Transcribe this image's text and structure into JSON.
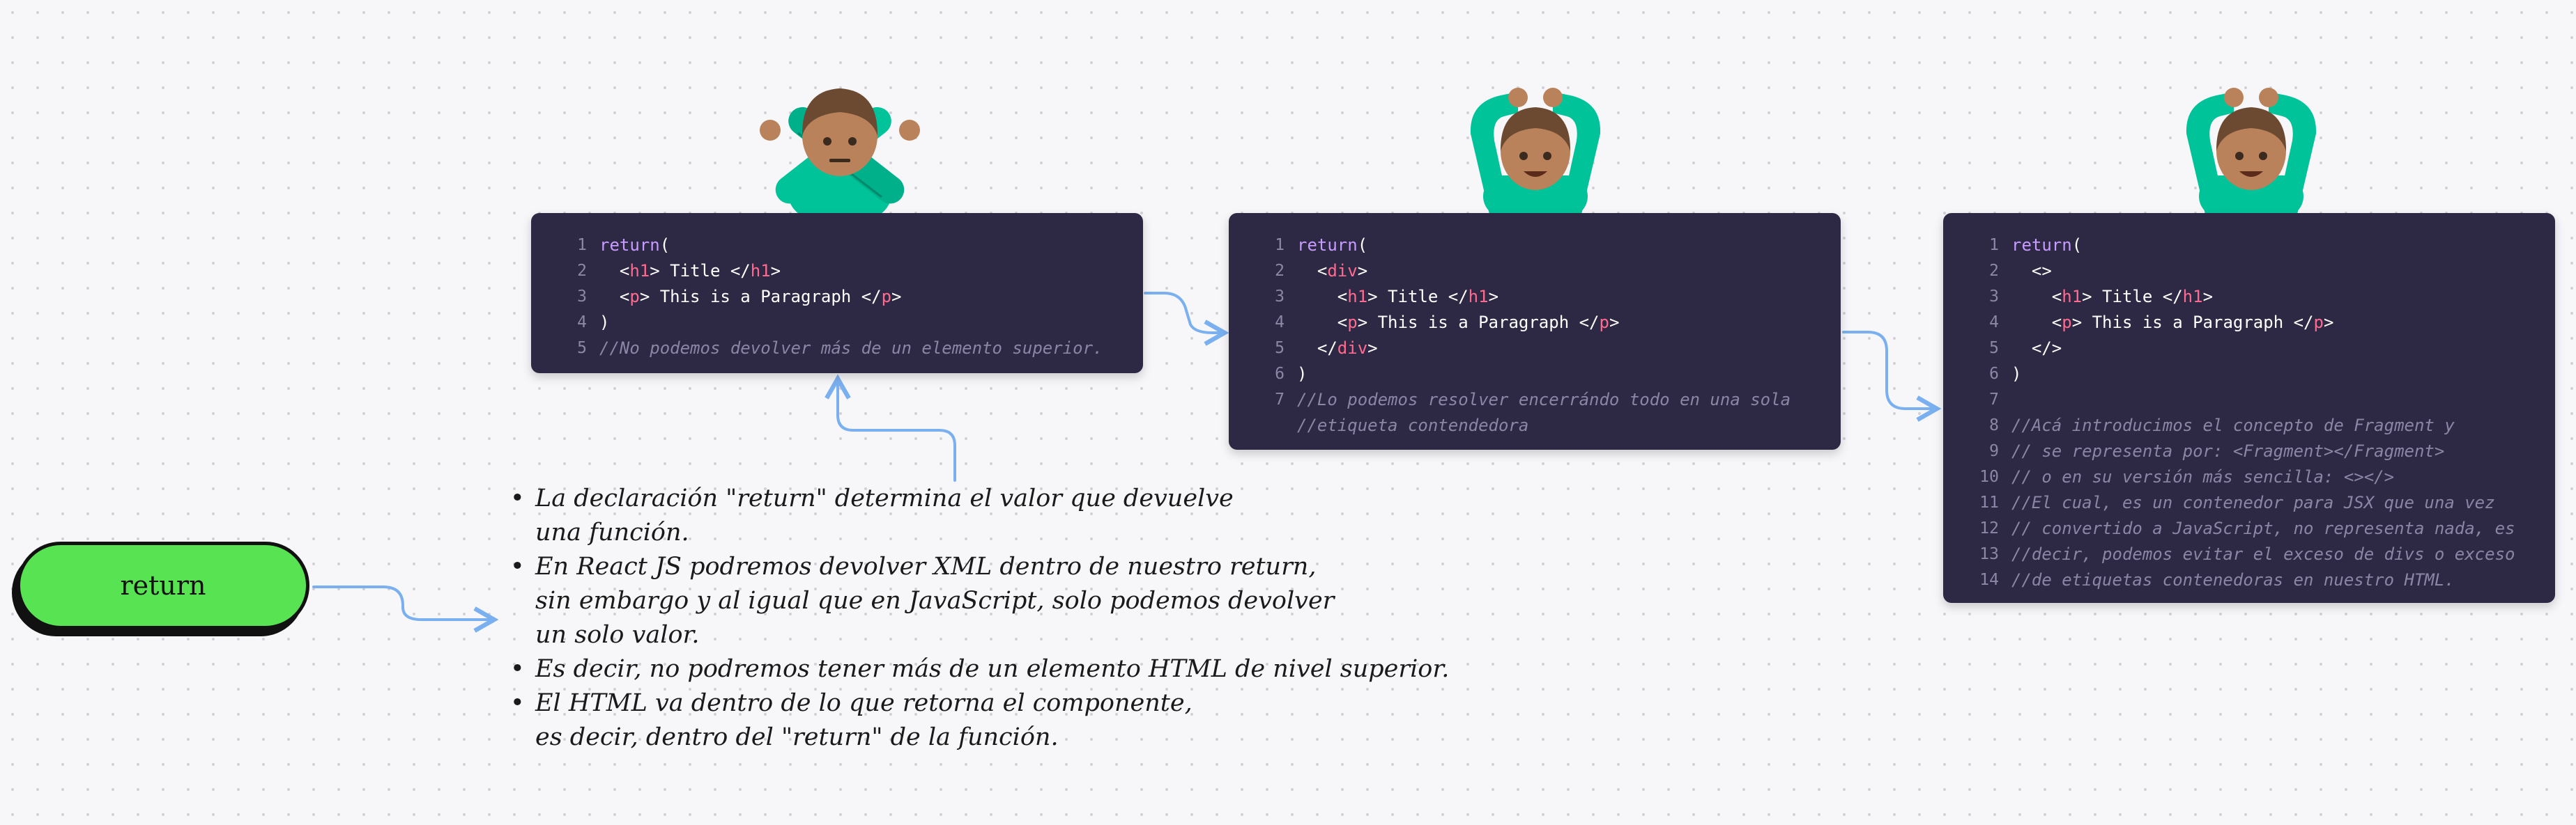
{
  "pill": {
    "label": "return"
  },
  "blocks": [
    {
      "id": "block-1",
      "lines": [
        {
          "n": "1",
          "segs": [
            [
              "kw",
              "return"
            ],
            [
              "p",
              "("
            ]
          ]
        },
        {
          "n": "2",
          "segs": [
            [
              "p",
              "  <"
            ],
            [
              "tag",
              "h1"
            ],
            [
              "p",
              "> Title </"
            ],
            [
              "tag",
              "h1"
            ],
            [
              "p",
              ">"
            ]
          ]
        },
        {
          "n": "3",
          "segs": [
            [
              "p",
              "  <"
            ],
            [
              "tag",
              "p"
            ],
            [
              "p",
              "> This is a Paragraph </"
            ],
            [
              "tag",
              "p"
            ],
            [
              "p",
              ">"
            ]
          ]
        },
        {
          "n": "4",
          "segs": [
            [
              "p",
              ")"
            ]
          ]
        },
        {
          "n": "5",
          "segs": [
            [
              "cm",
              "//No podemos devolver más de un elemento superior."
            ]
          ]
        }
      ]
    },
    {
      "id": "block-2",
      "lines": [
        {
          "n": "1",
          "segs": [
            [
              "kw",
              "return"
            ],
            [
              "p",
              "("
            ]
          ]
        },
        {
          "n": "2",
          "segs": [
            [
              "p",
              "  <"
            ],
            [
              "tag",
              "div"
            ],
            [
              "p",
              ">"
            ]
          ]
        },
        {
          "n": "3",
          "segs": [
            [
              "p",
              "    <"
            ],
            [
              "tag",
              "h1"
            ],
            [
              "p",
              "> Title </"
            ],
            [
              "tag",
              "h1"
            ],
            [
              "p",
              ">"
            ]
          ]
        },
        {
          "n": "4",
          "segs": [
            [
              "p",
              "    <"
            ],
            [
              "tag",
              "p"
            ],
            [
              "p",
              "> This is a Paragraph </"
            ],
            [
              "tag",
              "p"
            ],
            [
              "p",
              ">"
            ]
          ]
        },
        {
          "n": "5",
          "segs": [
            [
              "p",
              "  </"
            ],
            [
              "tag",
              "div"
            ],
            [
              "p",
              ">"
            ]
          ]
        },
        {
          "n": "6",
          "segs": [
            [
              "p",
              ")"
            ]
          ]
        },
        {
          "n": "7",
          "segs": [
            [
              "cm",
              "//Lo podemos resolver encerrándo todo en una sola"
            ]
          ]
        },
        {
          "n": "",
          "segs": [
            [
              "cm",
              "//etiqueta contendedora"
            ]
          ]
        }
      ]
    },
    {
      "id": "block-3",
      "lines": [
        {
          "n": "1",
          "segs": [
            [
              "kw",
              "return"
            ],
            [
              "p",
              "("
            ]
          ]
        },
        {
          "n": "2",
          "segs": [
            [
              "p",
              "  <>"
            ]
          ]
        },
        {
          "n": "3",
          "segs": [
            [
              "p",
              "    <"
            ],
            [
              "tag",
              "h1"
            ],
            [
              "p",
              "> Title </"
            ],
            [
              "tag",
              "h1"
            ],
            [
              "p",
              ">"
            ]
          ]
        },
        {
          "n": "4",
          "segs": [
            [
              "p",
              "    <"
            ],
            [
              "tag",
              "p"
            ],
            [
              "p",
              "> This is a Paragraph </"
            ],
            [
              "tag",
              "p"
            ],
            [
              "p",
              ">"
            ]
          ]
        },
        {
          "n": "5",
          "segs": [
            [
              "p",
              "  </>"
            ]
          ]
        },
        {
          "n": "6",
          "segs": [
            [
              "p",
              ")"
            ]
          ]
        },
        {
          "n": "7",
          "segs": [
            [
              "p",
              ""
            ]
          ]
        },
        {
          "n": "8",
          "segs": [
            [
              "cm",
              "//Acá introducimos el concepto de Fragment y"
            ]
          ]
        },
        {
          "n": "9",
          "segs": [
            [
              "cm",
              "// se representa por: <Fragment></Fragment>"
            ]
          ]
        },
        {
          "n": "10",
          "segs": [
            [
              "cm",
              "// o en su versión más sencilla: <></>"
            ]
          ]
        },
        {
          "n": "11",
          "segs": [
            [
              "cm",
              "//El cual, es un contenedor para JSX que una vez"
            ]
          ]
        },
        {
          "n": "12",
          "segs": [
            [
              "cm",
              "// convertido a JavaScript, no representa nada, es"
            ]
          ]
        },
        {
          "n": "13",
          "segs": [
            [
              "cm",
              "//decir, podemos evitar el exceso de divs o exceso"
            ]
          ]
        },
        {
          "n": "14",
          "segs": [
            [
              "cm",
              "//de etiquetas contenedoras en nuestro HTML."
            ]
          ]
        }
      ]
    }
  ],
  "notes": [
    [
      "La declaración \"return\" determina el valor que devuelve",
      "una función."
    ],
    [
      "En React JS podremos devolver XML dentro de nuestro return,",
      "sin embargo y al igual que en JavaScript, solo podemos devolver",
      "un solo valor."
    ],
    [
      "Es decir, no podremos tener más de un elemento HTML de nivel superior."
    ],
    [
      "El HTML va dentro de lo que retorna el componente,",
      "es decir, dentro del \"return\" de la función."
    ]
  ],
  "figures": [
    {
      "icon": "person-gesturing-no-icon"
    },
    {
      "icon": "person-gesturing-ok-icon"
    },
    {
      "icon": "person-gesturing-ok-icon"
    }
  ],
  "colors": {
    "code_bg": "#2d2844",
    "keyword": "#c79bff",
    "tag": "#ff6b8f",
    "comment": "#8a86a6",
    "line_number": "#8b87a6",
    "pill": "#58e353",
    "arrow": "#7ab0f0",
    "skin": "#b9825b",
    "hair": "#6b4a31",
    "shirt": "#00c39a"
  }
}
